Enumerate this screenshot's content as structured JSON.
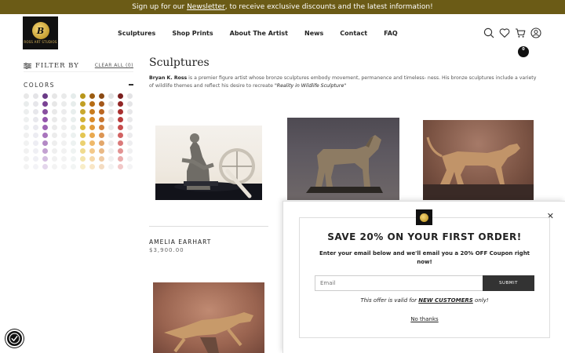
{
  "announcement": {
    "prefix": "Sign up for our ",
    "link": "Newsletter",
    "suffix": ", to receive exclusive discounts and the latest information!"
  },
  "header": {
    "logo_text": "ROSS ART STUDIOS",
    "nav": [
      "Sculptures",
      "Shop Prints",
      "About The Artist",
      "News",
      "Contact",
      "FAQ"
    ],
    "icons": [
      "search-icon",
      "heart-icon",
      "cart-icon",
      "account-icon"
    ],
    "cart_count": "0"
  },
  "sidebar": {
    "filter_label": "FILTER BY",
    "clear_all": "CLEAR ALL (0)",
    "colors_label": "COLORS",
    "swatch_columns": [
      [
        "#e8e8e8",
        "#e9ecec",
        "#eceeee",
        "#eef0f0",
        "#eef0f1",
        "#f0f0f0",
        "#f1f2f2",
        "#f1f1f1",
        "#f2f2f2",
        "#f3f3f3"
      ],
      [
        "#e4e4e7",
        "#e6e6ea",
        "#e7e7eb",
        "#e8e8ed",
        "#eaeaf0",
        "#ececf2",
        "#ededf3",
        "#efeff4",
        "#f0f0f5",
        "#f3f3f7"
      ],
      [
        "#6a3a86",
        "#7a4394",
        "#884f9f",
        "#9455ac",
        "#9d63b4",
        "#a874bd",
        "#b389c5",
        "#c3a1d1",
        "#d4bde0",
        "#e4d6ec"
      ],
      [
        "#e6e6e6",
        "#e7e7e7",
        "#e9e9e9",
        "#eaeaea",
        "#ebebeb",
        "#ececec",
        "#eeeeee",
        "#efefef",
        "#f1f1f1",
        "#f3f3f3"
      ],
      [
        "#e9eaea",
        "#ebecec",
        "#ececed",
        "#eeeeee",
        "#efefef",
        "#f0f0f0",
        "#f1f1f1",
        "#f2f2f2",
        "#f3f3f3",
        "#f5f5f5"
      ],
      [
        "#e5eceb",
        "#e7edec",
        "#e8eeed",
        "#e9efee",
        "#ebf0ef",
        "#ecf1f0",
        "#edf2f1",
        "#eff3f2",
        "#f0f4f3",
        "#f2f5f4"
      ],
      [
        "#b8961a",
        "#c19f24",
        "#c9a82d",
        "#d2b133",
        "#dcbb3c",
        "#e3c552",
        "#ebd171",
        "#f0db8f",
        "#f4e4ab",
        "#f8edc8"
      ],
      [
        "#9c5c10",
        "#b66c14",
        "#c87b1c",
        "#d98a28",
        "#e29a3a",
        "#e9a94f",
        "#efb96a",
        "#f3c98a",
        "#f6d8a8",
        "#f9e6c6"
      ],
      [
        "#8a4a13",
        "#a4581a",
        "#ba6621",
        "#c8742d",
        "#d3843e",
        "#dc9553",
        "#e3a76b",
        "#e9b986",
        "#efcba4",
        "#f4dcc2"
      ],
      [
        "#e2e3e3",
        "#e4e5e5",
        "#e6e7e7",
        "#e8e9e9",
        "#eaeaea",
        "#ebecec",
        "#edeeee",
        "#eff0f0",
        "#f1f1f1",
        "#f3f3f3"
      ],
      [
        "#7a1e1e",
        "#922626",
        "#a82f2f",
        "#b83c3c",
        "#c64d4d",
        "#d16262",
        "#da7a7a",
        "#e29393",
        "#eaadad",
        "#f1c8c8"
      ],
      [
        "#e3e3e5",
        "#e5e5e7",
        "#e7e7e9",
        "#e9e9eb",
        "#ebebec",
        "#ececee",
        "#eeeef0",
        "#f0f0f1",
        "#f2f2f3",
        "#f4f4f5"
      ]
    ]
  },
  "main": {
    "title": "Sculptures",
    "desc_bold": "Bryan K. Ross",
    "desc_text": " is a premier figure artist whose bronze sculptures embody movement, permanence and timeless- ness. His bronze sculptures include a variety of wildlife themes and reflect his desire to recreate ",
    "desc_italic": "\"Reality in Wildlife Sculpture\"",
    "products": [
      {
        "name": "AMELIA EARHART",
        "price": "$3,900.00"
      }
    ]
  },
  "popup": {
    "title": "SAVE 20% ON YOUR FIRST ORDER!",
    "subtitle": "Enter your email below and we'll email you a 20% OFF Coupon right now!",
    "email_placeholder": "Email",
    "submit": "SUBMIT",
    "note_prefix": "This offer is valid for ",
    "note_bold": "NEW CUSTOMERS",
    "note_suffix": " only!",
    "no_thanks": "No thanks",
    "close": "✕"
  },
  "colors": {
    "announcement_bg": "#6b5b16",
    "submit_bg": "#333333"
  }
}
